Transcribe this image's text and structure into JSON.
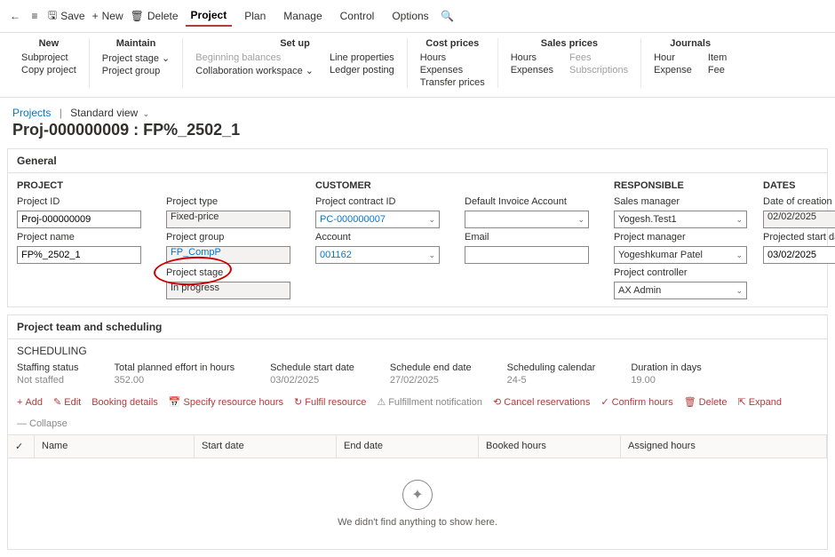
{
  "topbar": {
    "save": "Save",
    "new": "New",
    "delete": "Delete",
    "tabs": [
      "Project",
      "Plan",
      "Manage",
      "Control",
      "Options"
    ],
    "active_tab": 0
  },
  "ribbon": {
    "groups": [
      {
        "title": "New",
        "cols": [
          [
            "Subproject",
            "Copy project"
          ]
        ]
      },
      {
        "title": "Maintain",
        "cols": [
          [
            "Project stage ⌄",
            "Project group"
          ]
        ]
      },
      {
        "title": "Set up",
        "cols": [
          [
            "Beginning balances",
            "Collaboration workspace ⌄"
          ],
          [
            "Line properties",
            "Ledger posting"
          ]
        ]
      },
      {
        "title": "Cost prices",
        "cols": [
          [
            "Hours",
            "Expenses",
            "Transfer prices"
          ]
        ]
      },
      {
        "title": "Sales prices",
        "cols": [
          [
            "Hours",
            "Expenses"
          ],
          [
            "Fees",
            "Subscriptions"
          ]
        ]
      },
      {
        "title": "Journals",
        "cols": [
          [
            "Hour",
            "Expense"
          ],
          [
            "Item",
            "Fee"
          ]
        ]
      }
    ]
  },
  "breadcrumb": {
    "root": "Projects",
    "view": "Standard view"
  },
  "title": "Proj-000000009 : FP%_2502_1",
  "general": {
    "header": "General",
    "project": {
      "hd": "PROJECT",
      "id_label": "Project ID",
      "id": "Proj-000000009",
      "name_label": "Project name",
      "name": "FP%_2502_1",
      "type_label": "Project type",
      "type": "Fixed-price",
      "group_label": "Project group",
      "group": "FP_CompP",
      "stage_label": "Project stage",
      "stage": "In progress"
    },
    "customer": {
      "hd": "CUSTOMER",
      "contract_label": "Project contract ID",
      "contract": "PC-000000007",
      "account_label": "Account",
      "account": "001162",
      "default_inv_label": "Default Invoice Account",
      "default_inv": "",
      "email_label": "Email",
      "email": ""
    },
    "responsible": {
      "hd": "RESPONSIBLE",
      "sm_label": "Sales manager",
      "sm": "Yogesh.Test1",
      "pm_label": "Project manager",
      "pm": "Yogeshkumar Patel",
      "pc_label": "Project controller",
      "pc": "AX Admin"
    },
    "dates": {
      "hd": "DATES",
      "created_label": "Date of creation",
      "created": "02/02/2025",
      "start_label": "Projected start date",
      "start": "03/02/2025"
    }
  },
  "team": {
    "header": "Project team and scheduling",
    "sched_hd": "SCHEDULING",
    "cols": {
      "staffing_label": "Staffing status",
      "staffing": "Not staffed",
      "effort_label": "Total planned effort in hours",
      "effort": "352.00",
      "sstart_label": "Schedule start date",
      "sstart": "03/02/2025",
      "send_label": "Schedule end date",
      "send": "27/02/2025",
      "cal_label": "Scheduling calendar",
      "cal": "24-5",
      "dur_label": "Duration in days",
      "dur": "19.00"
    },
    "actions": {
      "add": "Add",
      "edit": "Edit",
      "booking": "Booking details",
      "specify": "Specify resource hours",
      "fulfil": "Fulfil resource",
      "notif": "Fulfillment notification",
      "cancel": "Cancel reservations",
      "confirm": "Confirm hours",
      "delete": "Delete",
      "expand": "Expand",
      "collapse": "Collapse"
    },
    "table": {
      "headers": [
        "",
        "Name",
        "Start date",
        "End date",
        "Booked hours",
        "Assigned hours"
      ],
      "empty": "We didn't find anything to show here."
    }
  }
}
